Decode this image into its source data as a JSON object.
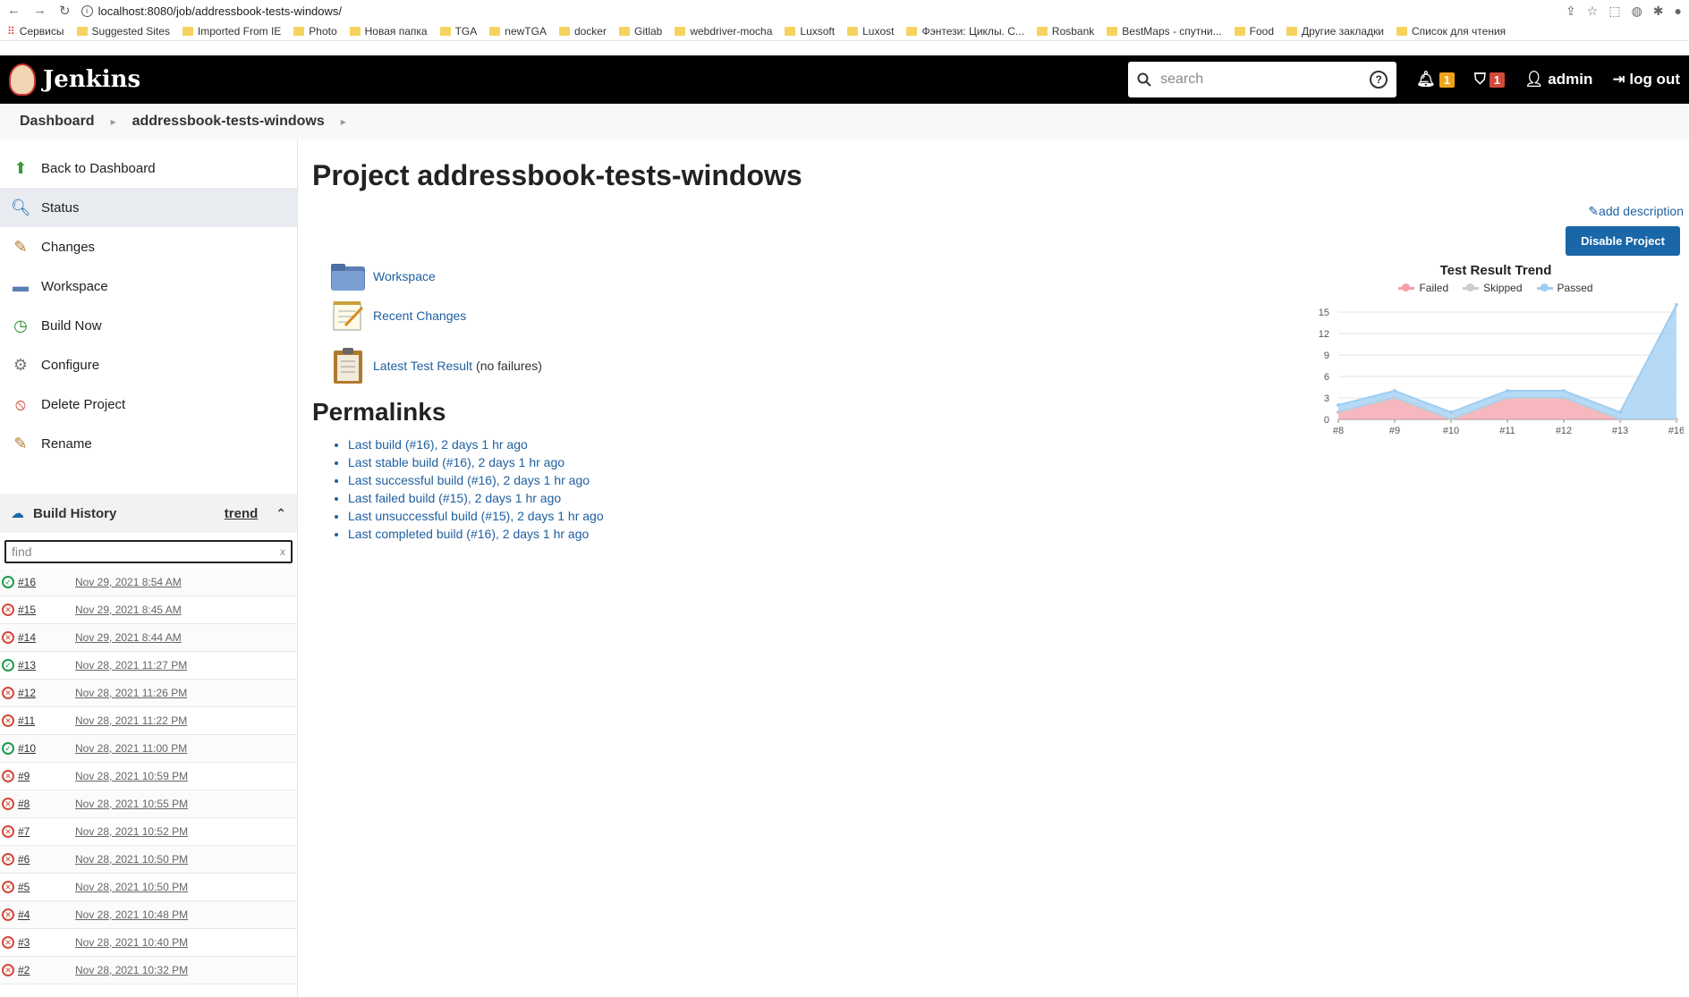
{
  "browser": {
    "url": "localhost:8080/job/addressbook-tests-windows/",
    "bookmarks": [
      "Сервисы",
      "Suggested Sites",
      "Imported From IE",
      "Photo",
      "Новая папка",
      "TGA",
      "newTGA",
      "docker",
      "Gitlab",
      "webdriver-mocha",
      "Luxsoft",
      "Luxost",
      "Фэнтези: Циклы. С...",
      "Rosbank",
      "BestMaps - спутни...",
      "Food",
      "Другие закладки",
      "Список для чтения"
    ]
  },
  "header": {
    "logo": "Jenkins",
    "search_placeholder": "search",
    "notifications_count": "1",
    "warnings_count": "1",
    "user": "admin",
    "logout": "log out"
  },
  "breadcrumb": {
    "items": [
      "Dashboard",
      "addressbook-tests-windows"
    ]
  },
  "sidebar": {
    "items": [
      {
        "label": "Back to Dashboard",
        "icon": "up-arrow-icon"
      },
      {
        "label": "Status",
        "icon": "search-icon"
      },
      {
        "label": "Changes",
        "icon": "notepad-icon"
      },
      {
        "label": "Workspace",
        "icon": "folder-icon"
      },
      {
        "label": "Build Now",
        "icon": "build-icon"
      },
      {
        "label": "Configure",
        "icon": "gear-icon"
      },
      {
        "label": "Delete Project",
        "icon": "no-entry-icon"
      },
      {
        "label": "Rename",
        "icon": "notepad-icon"
      }
    ],
    "build_history": {
      "title": "Build History",
      "trend": "trend",
      "find_placeholder": "find",
      "builds": [
        {
          "num": "#16",
          "date": "Nov 29, 2021 8:54 AM",
          "status": "success"
        },
        {
          "num": "#15",
          "date": "Nov 29, 2021 8:45 AM",
          "status": "failed"
        },
        {
          "num": "#14",
          "date": "Nov 29, 2021 8:44 AM",
          "status": "failed"
        },
        {
          "num": "#13",
          "date": "Nov 28, 2021 11:27 PM",
          "status": "success"
        },
        {
          "num": "#12",
          "date": "Nov 28, 2021 11:26 PM",
          "status": "failed"
        },
        {
          "num": "#11",
          "date": "Nov 28, 2021 11:22 PM",
          "status": "failed"
        },
        {
          "num": "#10",
          "date": "Nov 28, 2021 11:00 PM",
          "status": "success"
        },
        {
          "num": "#9",
          "date": "Nov 28, 2021 10:59 PM",
          "status": "failed"
        },
        {
          "num": "#8",
          "date": "Nov 28, 2021 10:55 PM",
          "status": "failed"
        },
        {
          "num": "#7",
          "date": "Nov 28, 2021 10:52 PM",
          "status": "failed"
        },
        {
          "num": "#6",
          "date": "Nov 28, 2021 10:50 PM",
          "status": "failed"
        },
        {
          "num": "#5",
          "date": "Nov 28, 2021 10:50 PM",
          "status": "failed"
        },
        {
          "num": "#4",
          "date": "Nov 28, 2021 10:48 PM",
          "status": "failed"
        },
        {
          "num": "#3",
          "date": "Nov 28, 2021 10:40 PM",
          "status": "failed"
        },
        {
          "num": "#2",
          "date": "Nov 28, 2021 10:32 PM",
          "status": "failed"
        }
      ]
    }
  },
  "main": {
    "title": "Project addressbook-tests-windows",
    "add_description": "add description",
    "disable_button": "Disable Project",
    "links": [
      {
        "label": "Workspace",
        "icon": "folder-icon",
        "suffix": ""
      },
      {
        "label": "Recent Changes",
        "icon": "notepad-icon",
        "suffix": ""
      },
      {
        "label": "Latest Test Result",
        "icon": "clipboard-icon",
        "suffix": "(no failures)"
      }
    ],
    "permalinks_title": "Permalinks",
    "permalinks": [
      "Last build (#16), 2 days 1 hr ago",
      "Last stable build (#16), 2 days 1 hr ago",
      "Last successful build (#16), 2 days 1 hr ago",
      "Last failed build (#15), 2 days 1 hr ago",
      "Last unsuccessful build (#15), 2 days 1 hr ago",
      "Last completed build (#16), 2 days 1 hr ago"
    ]
  },
  "chart_data": {
    "type": "area",
    "title": "Test Result Trend",
    "categories": [
      "#8",
      "#9",
      "#10",
      "#11",
      "#12",
      "#13",
      "#16"
    ],
    "yticks": [
      0,
      3,
      6,
      9,
      12,
      15
    ],
    "ylim": [
      0,
      15
    ],
    "series": [
      {
        "name": "Failed",
        "color": "#f3a0a8",
        "values": [
          1,
          3,
          0,
          3,
          3,
          0,
          0
        ]
      },
      {
        "name": "Skipped",
        "color": "#cccccc",
        "values": [
          0,
          0,
          0,
          0,
          0,
          0,
          0
        ]
      },
      {
        "name": "Passed",
        "color": "#9ecdf2",
        "values": [
          1,
          1,
          1,
          1,
          1,
          1,
          16
        ]
      }
    ],
    "legend": "top"
  }
}
